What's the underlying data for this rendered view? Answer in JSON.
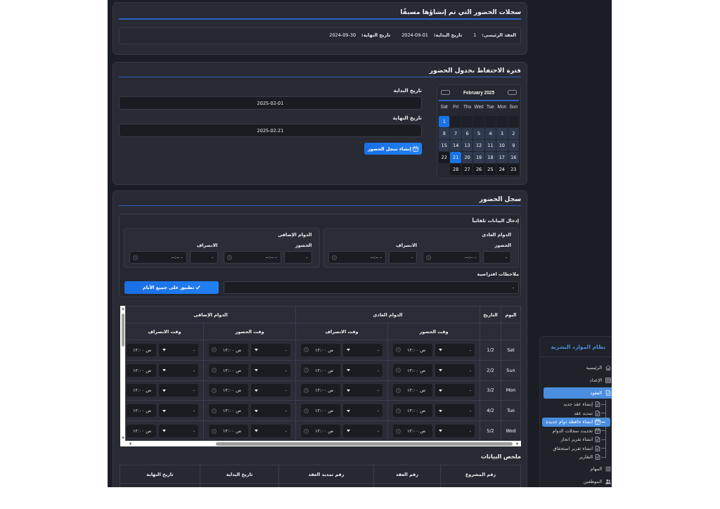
{
  "previous_records": {
    "title": "سجلات الحضور التي تم إنشاؤها مسبقًا",
    "records": [
      {
        "fields": [
          {
            "label": "العقد الرئيسي:",
            "value": "1"
          },
          {
            "label": "تاريخ البداية:",
            "value": "2024-09-01"
          },
          {
            "label": "تاريخ النهاية:",
            "value": "2024-09-30"
          }
        ]
      }
    ]
  },
  "retention_period": {
    "title": "فترة الاحتفاظ بجدول الحضور",
    "calendar": {
      "month": "February 2025",
      "weekdays": [
        "Sun",
        "Mon",
        "Tue",
        "Wed",
        "Thu",
        "Fri",
        "Sat"
      ],
      "weeks": [
        [
          {
            "kind": "blank"
          },
          {
            "kind": "blank"
          },
          {
            "kind": "blank"
          },
          {
            "kind": "blank"
          },
          {
            "kind": "blank"
          },
          {
            "kind": "blank"
          },
          {
            "kind": "day",
            "day": "1",
            "selected": true,
            "in_range": false
          }
        ],
        [
          {
            "kind": "day",
            "day": "2",
            "selected": false,
            "in_range": true
          },
          {
            "kind": "day",
            "day": "3",
            "selected": false,
            "in_range": true
          },
          {
            "kind": "day",
            "day": "4",
            "selected": false,
            "in_range": true
          },
          {
            "kind": "day",
            "day": "5",
            "selected": false,
            "in_range": true
          },
          {
            "kind": "day",
            "day": "6",
            "selected": false,
            "in_range": true
          },
          {
            "kind": "day",
            "day": "7",
            "selected": false,
            "in_range": true
          },
          {
            "kind": "day",
            "day": "8",
            "selected": false,
            "in_range": true
          }
        ],
        [
          {
            "kind": "day",
            "day": "9",
            "selected": false,
            "in_range": true
          },
          {
            "kind": "day",
            "day": "10",
            "selected": false,
            "in_range": true
          },
          {
            "kind": "day",
            "day": "11",
            "selected": false,
            "in_range": true
          },
          {
            "kind": "day",
            "day": "12",
            "selected": false,
            "in_range": true
          },
          {
            "kind": "day",
            "day": "13",
            "selected": false,
            "in_range": true
          },
          {
            "kind": "day",
            "day": "14",
            "selected": false,
            "in_range": true
          },
          {
            "kind": "day",
            "day": "15",
            "selected": false,
            "in_range": true
          }
        ],
        [
          {
            "kind": "day",
            "day": "16",
            "selected": false,
            "in_range": true
          },
          {
            "kind": "day",
            "day": "17",
            "selected": false,
            "in_range": true
          },
          {
            "kind": "day",
            "day": "18",
            "selected": false,
            "in_range": true
          },
          {
            "kind": "day",
            "day": "19",
            "selected": false,
            "in_range": true
          },
          {
            "kind": "day",
            "day": "20",
            "selected": false,
            "in_range": true
          },
          {
            "kind": "day",
            "day": "21",
            "selected": true,
            "in_range": false
          },
          {
            "kind": "day",
            "day": "22",
            "selected": false,
            "in_range": false
          }
        ],
        [
          {
            "kind": "day",
            "day": "23",
            "selected": false,
            "in_range": false
          },
          {
            "kind": "day",
            "day": "24",
            "selected": false,
            "in_range": false
          },
          {
            "kind": "day",
            "day": "25",
            "selected": false,
            "in_range": false
          },
          {
            "kind": "day",
            "day": "26",
            "selected": false,
            "in_range": false
          },
          {
            "kind": "day",
            "day": "27",
            "selected": false,
            "in_range": false
          },
          {
            "kind": "day",
            "day": "28",
            "selected": false,
            "in_range": false
          }
        ]
      ]
    },
    "start_date": {
      "label": "تاريخ البداية",
      "value": "2025-02-01"
    },
    "end_date": {
      "label": "تاريخ النهاية",
      "value": "2025-02-21"
    },
    "create_button": "إنشاء سجل الحضور"
  },
  "attendance_log": {
    "title": "سجل الحضور",
    "auto_fill": {
      "title": "إدخال البيانات تلقائياً",
      "shifts": [
        {
          "title": "الدوام العادي",
          "fields": [
            {
              "label": "الحضور",
              "option": "-",
              "time": "--:-- -"
            },
            {
              "label": "الانصراف",
              "option": "-",
              "time": "--:-- -"
            }
          ]
        },
        {
          "title": "الدوام الإضافي",
          "fields": [
            {
              "label": "الحضور",
              "option": "-",
              "time": "--:-- -"
            },
            {
              "label": "الانصراف",
              "option": "-",
              "time": "--:-- -"
            }
          ]
        }
      ],
      "notes": {
        "label": "ملاحظات افتراضية",
        "value": "-"
      },
      "apply_button": "تطبيق على جميع الأيام"
    },
    "table": {
      "columns": [
        {
          "label": "اليوم"
        },
        {
          "label": "التاريخ"
        },
        {
          "label": "الدوام العادي",
          "children": [
            {
              "label": "وقت الحضور"
            },
            {
              "label": "وقت الانصراف"
            }
          ]
        },
        {
          "label": "الدوام الإضافي",
          "children": [
            {
              "label": "وقت الحضور"
            },
            {
              "label": "وقت الانصراف"
            }
          ]
        }
      ],
      "rows": [
        {
          "day": "Sat",
          "date": "1/2",
          "times": [
            {
              "option": "-",
              "time": "ص ١٢:٠٠"
            },
            {
              "option": "-",
              "time": "ص ١٢:٠٠"
            },
            {
              "option": "-",
              "time": "ص ١٢:٠٠"
            },
            {
              "option": "-",
              "time": "ص ١٢:٠٠"
            }
          ]
        },
        {
          "day": "Sun",
          "date": "2/2",
          "times": [
            {
              "option": "-",
              "time": "ص ١٢:٠٠"
            },
            {
              "option": "-",
              "time": "ص ١٢:٠٠"
            },
            {
              "option": "-",
              "time": "ص ١٢:٠٠"
            },
            {
              "option": "-",
              "time": "ص ١٢:٠٠"
            }
          ]
        },
        {
          "day": "Mon",
          "date": "3/2",
          "times": [
            {
              "option": "-",
              "time": "ص ١٢:٠٠"
            },
            {
              "option": "-",
              "time": "ص ١٢:٠٠"
            },
            {
              "option": "-",
              "time": "ص ١٢:٠٠"
            },
            {
              "option": "-",
              "time": "ص ١٢:٠٠"
            }
          ]
        },
        {
          "day": "Tue",
          "date": "4/2",
          "times": [
            {
              "option": "-",
              "time": "ص ١٢:٠٠"
            },
            {
              "option": "-",
              "time": "ص ١٢:٠٠"
            },
            {
              "option": "-",
              "time": "ص ١٢:٠٠"
            },
            {
              "option": "-",
              "time": "ص ١٢:٠٠"
            }
          ]
        },
        {
          "day": "Wed",
          "date": "5/2",
          "times": [
            {
              "option": "-",
              "time": "ص ١٢:٠٠"
            },
            {
              "option": "-",
              "time": "ص ١٢:٠٠"
            },
            {
              "option": "-",
              "time": "ص ١٢:٠٠"
            },
            {
              "option": "-",
              "time": "ص ١٢:٠٠"
            }
          ]
        }
      ]
    },
    "summary": {
      "title": "ملخص البيانات",
      "columns": [
        "رقم المشروع",
        "رقم العقد",
        "رقم تمديد العقد",
        "تاريخ البداية",
        "تاريخ النهاية"
      ]
    }
  },
  "sidebar": {
    "title": "نظام الموارد البشرية",
    "items": [
      {
        "label": "الرئيسية",
        "selected": false
      },
      {
        "label": "الإعداد",
        "selected": false
      },
      {
        "label": "العقود",
        "selected": true,
        "children": [
          {
            "label": "إنشاء عقد جديد",
            "selected": false
          },
          {
            "label": "تمديد عقد",
            "selected": false
          },
          {
            "label": "انشاء حافظة دوام جديدة",
            "selected": true
          },
          {
            "label": "تحديث سجلات الدوام",
            "selected": false
          },
          {
            "label": "انشاء تقرير انجاز",
            "selected": false
          },
          {
            "label": "انشاء تقرير استحقاق",
            "selected": false
          },
          {
            "label": "التقارير",
            "selected": false
          }
        ]
      },
      {
        "label": "المهام",
        "selected": false
      },
      {
        "label": "الموظفين",
        "selected": false
      }
    ]
  }
}
